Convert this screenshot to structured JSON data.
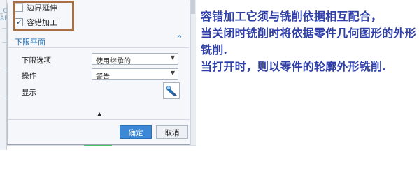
{
  "background": {
    "fragments": [
      "_C",
      "AR"
    ]
  },
  "dialog": {
    "options": [
      {
        "label": "边界延伸",
        "checked": false
      },
      {
        "label": "容错加工",
        "checked": true
      }
    ],
    "section": {
      "title": "下限平面",
      "collapse_icon": "chevron-up-icon"
    },
    "fields": [
      {
        "label": "下限选项",
        "value": "使用继承的"
      },
      {
        "label": "操作",
        "value": "警告"
      },
      {
        "label": "显示",
        "icon": "flashlight-icon"
      }
    ],
    "expand_icon": "triangle-up-icon",
    "buttons": {
      "ok": "确定",
      "cancel": "取消"
    }
  },
  "annotation": {
    "color": "#2e3fa8",
    "lines": [
      "容错加工它须与铣削依据相互配合，",
      "当关闭时铣削时将依据零件几何图形的外形铣削.",
      "当打开时，则以零件的轮廓外形铣削."
    ]
  },
  "colors": {
    "highlight_border": "#a77043",
    "section_title": "#1f6fb6",
    "ok_button": "#3b89d6"
  }
}
